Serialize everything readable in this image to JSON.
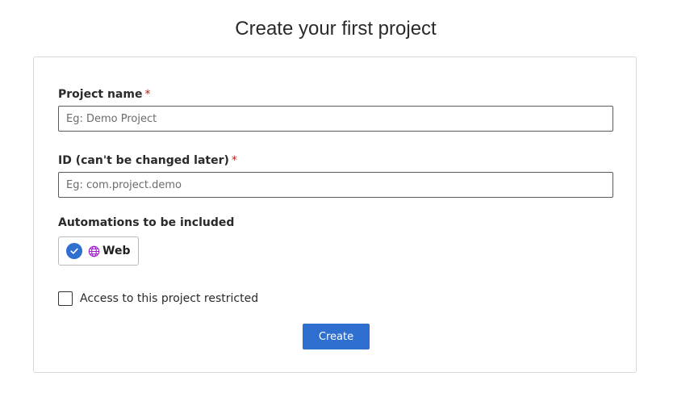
{
  "page": {
    "title": "Create your first project"
  },
  "form": {
    "project_name": {
      "label": "Project name",
      "required_mark": "*",
      "value": "",
      "placeholder": "Eg: Demo Project"
    },
    "project_id": {
      "label": "ID (can't be changed later)",
      "required_mark": "*",
      "value": "",
      "placeholder": "Eg: com.project.demo"
    },
    "automations": {
      "label": "Automations to be included",
      "options": [
        {
          "label": "Web",
          "selected": true,
          "icon": "globe-icon",
          "check_icon": "checkmark-circle-icon"
        }
      ]
    },
    "restricted_access": {
      "label": "Access to this project restricted",
      "checked": false
    },
    "submit_label": "Create"
  },
  "colors": {
    "accent": "#2f6fd0",
    "required": "#b3261e",
    "globe": "#a020c8",
    "card_border": "#d9d9d9"
  }
}
